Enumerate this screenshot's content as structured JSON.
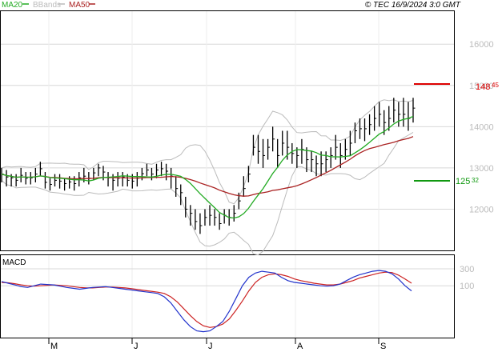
{
  "header": {
    "legend": [
      {
        "label": "MA20",
        "color": "#22aa22"
      },
      {
        "label": "BBands",
        "color": "#bbbbbb"
      },
      {
        "label": "MA50",
        "color": "#aa2222"
      }
    ],
    "copyright": "© TEC 16/9/2024 3:0 GMT"
  },
  "colors": {
    "price": "#000000",
    "ma20": "#22aa22",
    "ma50": "#aa2222",
    "bbands": "#bbbbbb",
    "macd": "#2233cc",
    "signal": "#cc2222",
    "resistance": "#dd0000",
    "support": "#119911",
    "grid": "#d8d8d8"
  },
  "chart_data": [
    {
      "type": "line",
      "name": "price",
      "x_ticks": [
        "M",
        "J",
        "J",
        "A",
        "S"
      ],
      "y_ticks": [
        12000,
        13000,
        14000,
        15000,
        16000
      ],
      "ylim": [
        11000,
        16800
      ],
      "grid": true,
      "x": [
        0,
        2,
        4,
        6,
        8,
        10,
        12,
        14,
        16,
        18,
        20,
        22,
        24,
        26,
        28,
        30,
        32,
        34,
        36,
        38,
        40,
        42,
        44,
        46,
        48,
        50,
        52,
        54,
        56,
        58,
        60,
        62,
        64,
        66,
        68,
        70,
        72,
        74,
        76,
        78,
        80,
        82,
        84,
        86,
        88,
        90,
        92,
        94,
        96,
        98,
        100,
        102,
        104,
        106,
        108,
        110,
        112,
        114,
        116,
        118,
        120,
        122,
        124,
        126,
        128,
        130,
        132,
        134,
        136,
        138,
        140,
        142,
        144,
        146,
        148,
        150,
        152,
        154,
        156,
        158,
        160,
        162,
        164,
        166,
        168,
        170
      ],
      "price_close": [
        12850,
        12780,
        12760,
        12700,
        12820,
        12750,
        12760,
        12850,
        12980,
        12650,
        12600,
        12700,
        12680,
        12620,
        12660,
        12620,
        12760,
        12800,
        12750,
        12880,
        13000,
        12900,
        12760,
        12700,
        12750,
        12780,
        12700,
        12680,
        12750,
        12860,
        12950,
        12850,
        12950,
        12980,
        12920,
        12800,
        12500,
        12400,
        12000,
        11900,
        11700,
        11600,
        11800,
        11850,
        11800,
        11650,
        11850,
        11800,
        11900,
        12200,
        12500,
        12850,
        13500,
        13400,
        13300,
        13500,
        13700,
        13300,
        13600,
        13500,
        13350,
        13300,
        13450,
        13200,
        13200,
        13100,
        13100,
        13200,
        13300,
        13500,
        13300,
        13450,
        13600,
        13900,
        13950,
        13950,
        14050,
        14200,
        14300,
        14100,
        14200,
        14400,
        14300,
        14300,
        14200,
        14450
      ],
      "price_high": [
        13000,
        12950,
        12850,
        12850,
        13000,
        12900,
        12900,
        13000,
        13150,
        12900,
        12750,
        12850,
        12850,
        12750,
        12800,
        12800,
        12900,
        13000,
        12900,
        13000,
        13100,
        13050,
        12900,
        12850,
        12900,
        12900,
        12850,
        12850,
        12900,
        13000,
        13100,
        13000,
        13100,
        13150,
        13100,
        13000,
        12800,
        12600,
        12300,
        12100,
        12000,
        11900,
        12000,
        12100,
        12000,
        11900,
        12000,
        12000,
        12100,
        12400,
        12800,
        13050,
        13800,
        13800,
        13700,
        13700,
        14000,
        13700,
        13900,
        13900,
        13600,
        13500,
        13700,
        13500,
        13400,
        13300,
        13400,
        13400,
        13500,
        13800,
        13600,
        13700,
        13900,
        14100,
        14200,
        14200,
        14300,
        14500,
        14600,
        14400,
        14500,
        14700,
        14600,
        14700,
        14600,
        14700
      ],
      "price_low": [
        12650,
        12550,
        12550,
        12550,
        12650,
        12600,
        12600,
        12650,
        12800,
        12500,
        12450,
        12550,
        12500,
        12450,
        12500,
        12450,
        12550,
        12650,
        12600,
        12700,
        12800,
        12700,
        12550,
        12450,
        12550,
        12550,
        12550,
        12500,
        12550,
        12700,
        12800,
        12700,
        12750,
        12800,
        12700,
        12500,
        12300,
        12100,
        11800,
        11600,
        11500,
        11400,
        11600,
        11600,
        11600,
        11500,
        11650,
        11600,
        11700,
        12000,
        12300,
        12650,
        13300,
        13100,
        13000,
        13200,
        13400,
        13000,
        13300,
        13200,
        13100,
        13000,
        13100,
        12900,
        12900,
        12800,
        12800,
        12900,
        13000,
        13200,
        13000,
        13200,
        13300,
        13600,
        13700,
        13650,
        13800,
        13900,
        14000,
        13800,
        13900,
        14100,
        14000,
        14000,
        13900,
        14100
      ]
    },
    {
      "type": "line",
      "name": "MACD",
      "x_ticks": [
        "M",
        "J",
        "J",
        "A",
        "S"
      ],
      "y_ticks": [
        100,
        300
      ],
      "ylim": [
        -500,
        450
      ],
      "grid": true,
      "macd": [
        150,
        130,
        110,
        90,
        80,
        100,
        120,
        115,
        110,
        95,
        80,
        70,
        60,
        70,
        80,
        85,
        90,
        80,
        70,
        60,
        50,
        40,
        30,
        20,
        10,
        -30,
        -100,
        -200,
        -300,
        -380,
        -430,
        -440,
        -430,
        -380,
        -320,
        -200,
        -50,
        100,
        200,
        250,
        270,
        260,
        250,
        200,
        160,
        140,
        130,
        120,
        110,
        100,
        95,
        100,
        120,
        160,
        200,
        230,
        250,
        270,
        280,
        270,
        240,
        180,
        100,
        40
      ],
      "signal": [
        140,
        135,
        125,
        110,
        100,
        95,
        100,
        105,
        110,
        105,
        100,
        90,
        80,
        75,
        75,
        80,
        85,
        85,
        80,
        75,
        65,
        55,
        45,
        35,
        25,
        10,
        -30,
        -90,
        -170,
        -250,
        -320,
        -370,
        -390,
        -380,
        -350,
        -290,
        -190,
        -80,
        40,
        140,
        200,
        230,
        240,
        230,
        210,
        180,
        160,
        145,
        130,
        120,
        110,
        110,
        120,
        140,
        160,
        190,
        210,
        230,
        250,
        260,
        255,
        225,
        180,
        130
      ]
    }
  ],
  "annotations": {
    "resistance_label": "148",
    "resistance_label_small": "45",
    "support_label": "125",
    "support_label_small": "32",
    "panel_label": "MACD"
  }
}
